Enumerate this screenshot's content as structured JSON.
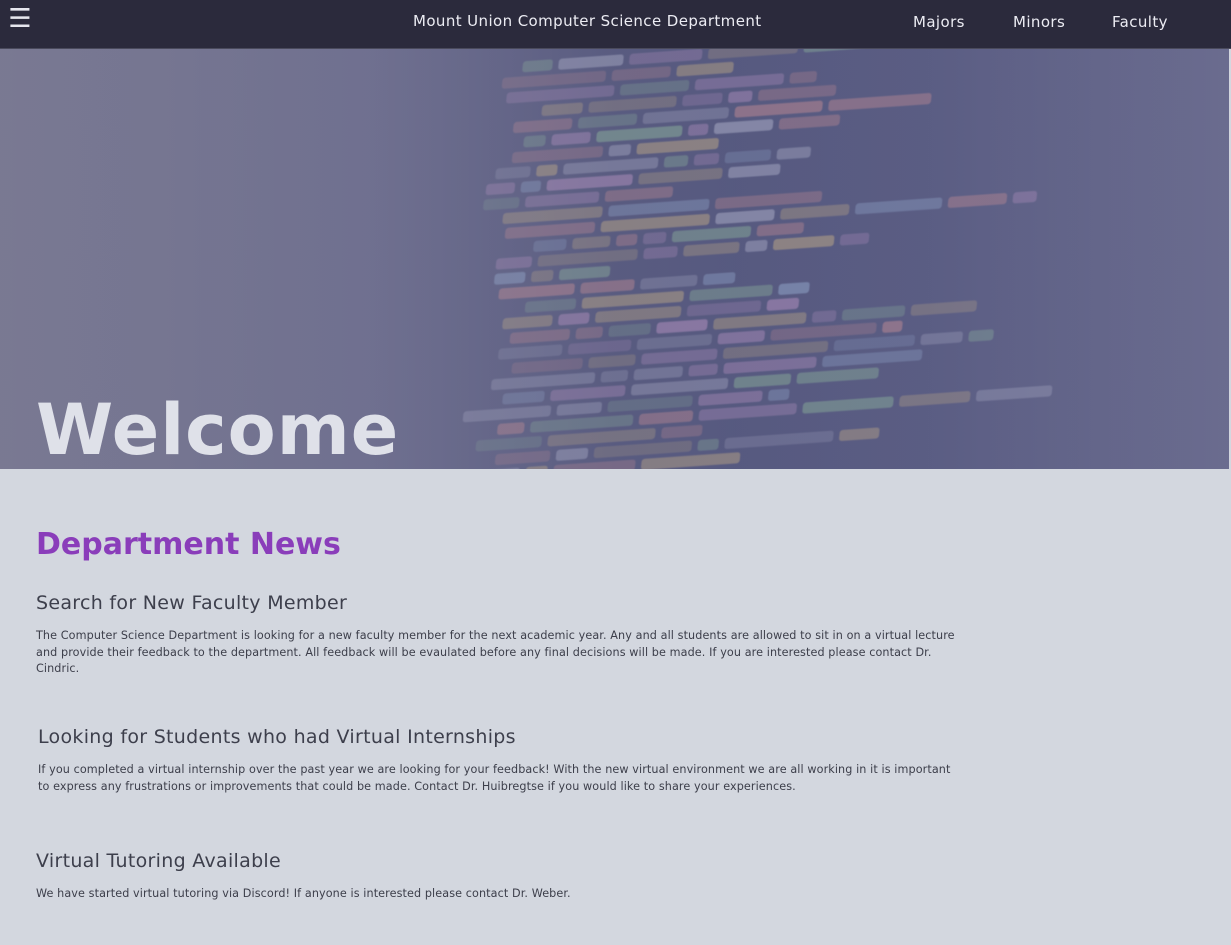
{
  "header": {
    "menu_icon": "hamburger-menu-icon",
    "menu_glyph": "☰",
    "site_title": "Mount Union Computer Science Department",
    "nav": [
      {
        "label": "Majors"
      },
      {
        "label": "Minors"
      },
      {
        "label": "Faculty"
      }
    ]
  },
  "hero": {
    "title": "Welcome"
  },
  "news": {
    "heading": "Department News",
    "items": [
      {
        "title": "Search for New Faculty Member",
        "body": "The Computer Science Department is looking for a new faculty member for the next academic year. Any and all students are allowed to sit in on a virtual lecture and provide their feedback to the department. All feedback will be evaulated before any final decisions will be made. If you are interested please contact Dr. Cindric."
      },
      {
        "title": "Looking for Students who had Virtual Internships",
        "body": "If you completed a virtual internship over the past year we are looking for your feedback! With the new virtual environment we are all working in it is important to express any frustrations or improvements that could be made. Contact Dr. Huibregtse if you would like to share your experiences."
      },
      {
        "title": "Virtual Tutoring Available",
        "body": "We have started virtual tutoring via Discord! If anyone is interested please contact Dr. Weber."
      }
    ]
  },
  "colors": {
    "nav_bg": "#2b2a3c",
    "accent_purple": "#8a3dba",
    "page_bg": "#d3d7df"
  }
}
